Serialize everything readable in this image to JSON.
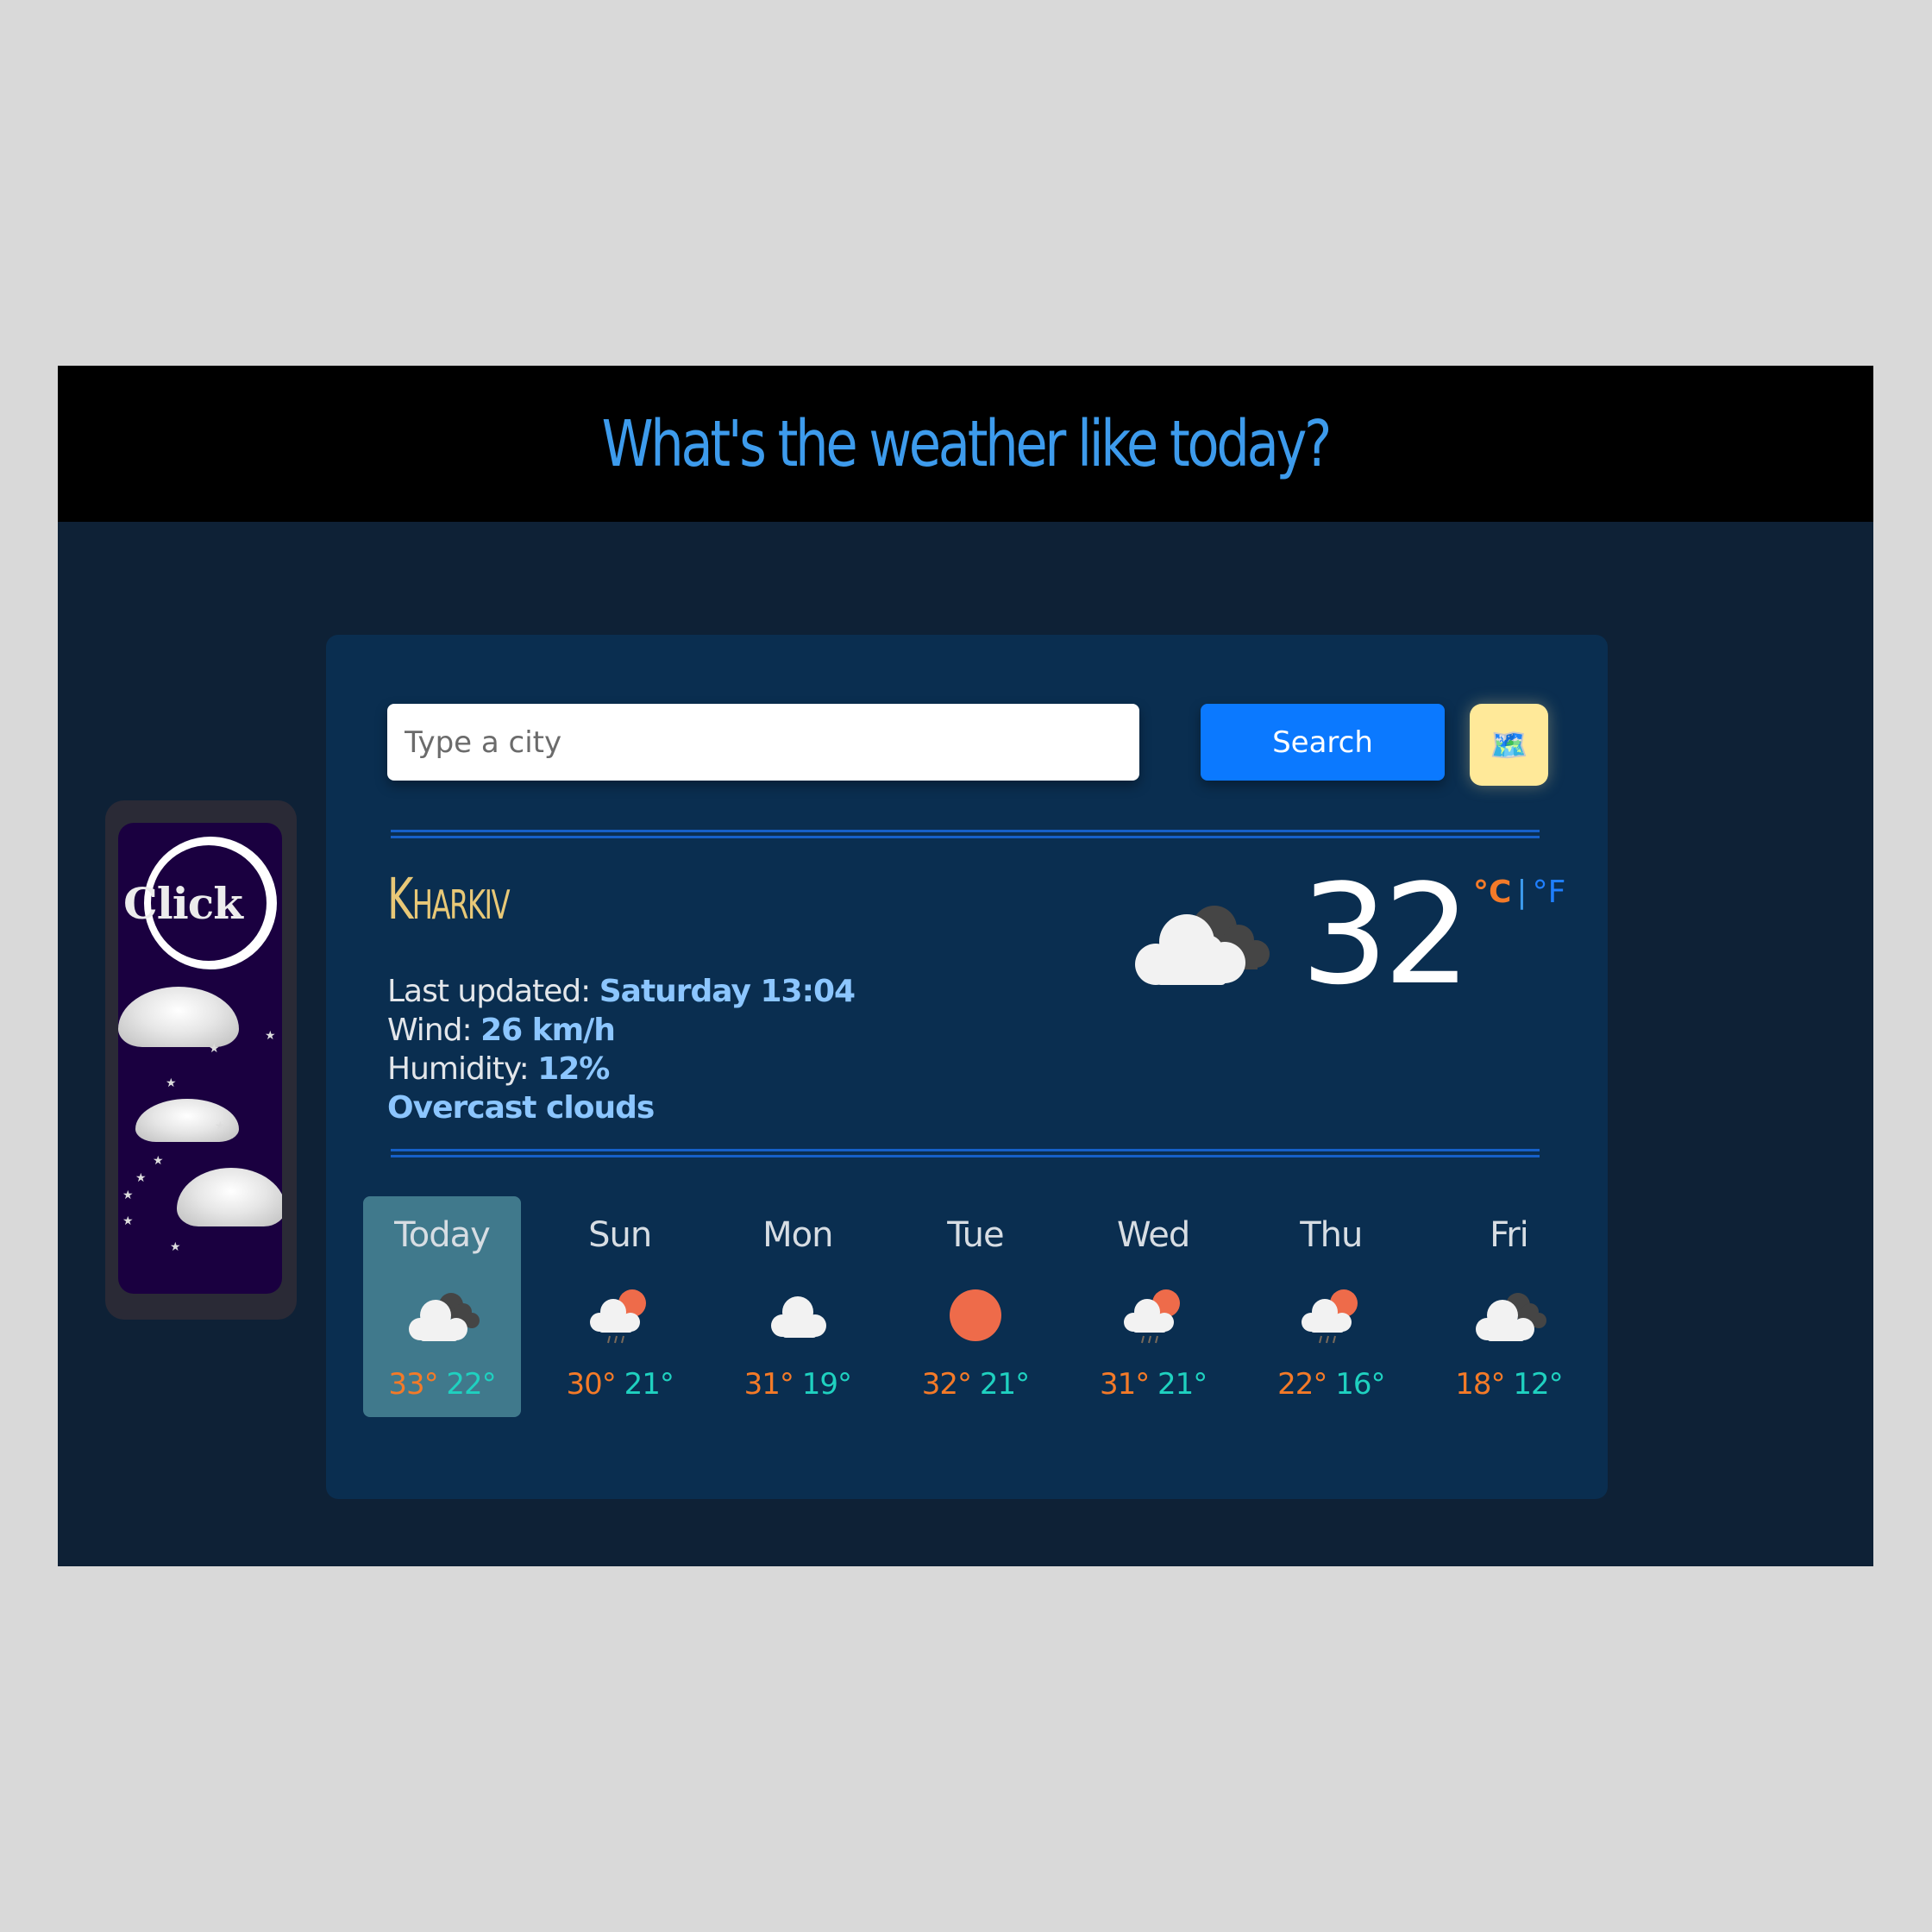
{
  "header": {
    "title": "What's the weather like today?"
  },
  "banner": {
    "label": "Click"
  },
  "search": {
    "placeholder": "Type a city",
    "value": "",
    "button_label": "Search",
    "map_button_icon": "🗺️"
  },
  "current": {
    "city": "Kharkiv",
    "last_updated_label": "Last updated:",
    "last_updated_value": "Saturday 13:04",
    "wind_label": "Wind:",
    "wind_value": "26 km/h",
    "humidity_label": "Humidity:",
    "humidity_value": "12%",
    "description": "Overcast clouds",
    "icon": "overcast-clouds",
    "temperature": "32",
    "unit_celsius": "°C",
    "unit_separator": "|",
    "unit_fahrenheit": "°F",
    "active_unit": "celsius"
  },
  "forecast": [
    {
      "day": "Today",
      "icon": "overcast-clouds",
      "high": "33°",
      "low": "22°",
      "active": true
    },
    {
      "day": "Sun",
      "icon": "sun-rain",
      "high": "30°",
      "low": "21°",
      "active": false
    },
    {
      "day": "Mon",
      "icon": "cloud",
      "high": "31°",
      "low": "19°",
      "active": false
    },
    {
      "day": "Tue",
      "icon": "sun",
      "high": "32°",
      "low": "21°",
      "active": false
    },
    {
      "day": "Wed",
      "icon": "sun-rain",
      "high": "31°",
      "low": "21°",
      "active": false
    },
    {
      "day": "Thu",
      "icon": "sun-rain",
      "high": "22°",
      "low": "16°",
      "active": false
    },
    {
      "day": "Fri",
      "icon": "overcast-clouds",
      "high": "18°",
      "low": "12°",
      "active": false
    }
  ],
  "colors": {
    "title_blue": "#3d9bec",
    "panel": "#0a2e50",
    "background": "#0e2136",
    "search_button": "#0b79ff",
    "map_button": "#ffe999",
    "city_gold": "#e8c877",
    "value_blue": "#8cc6ff",
    "high_temp": "#f47a28",
    "low_temp": "#1fd1c0",
    "active_day": "#40798c",
    "sun": "#ee6b4a"
  }
}
